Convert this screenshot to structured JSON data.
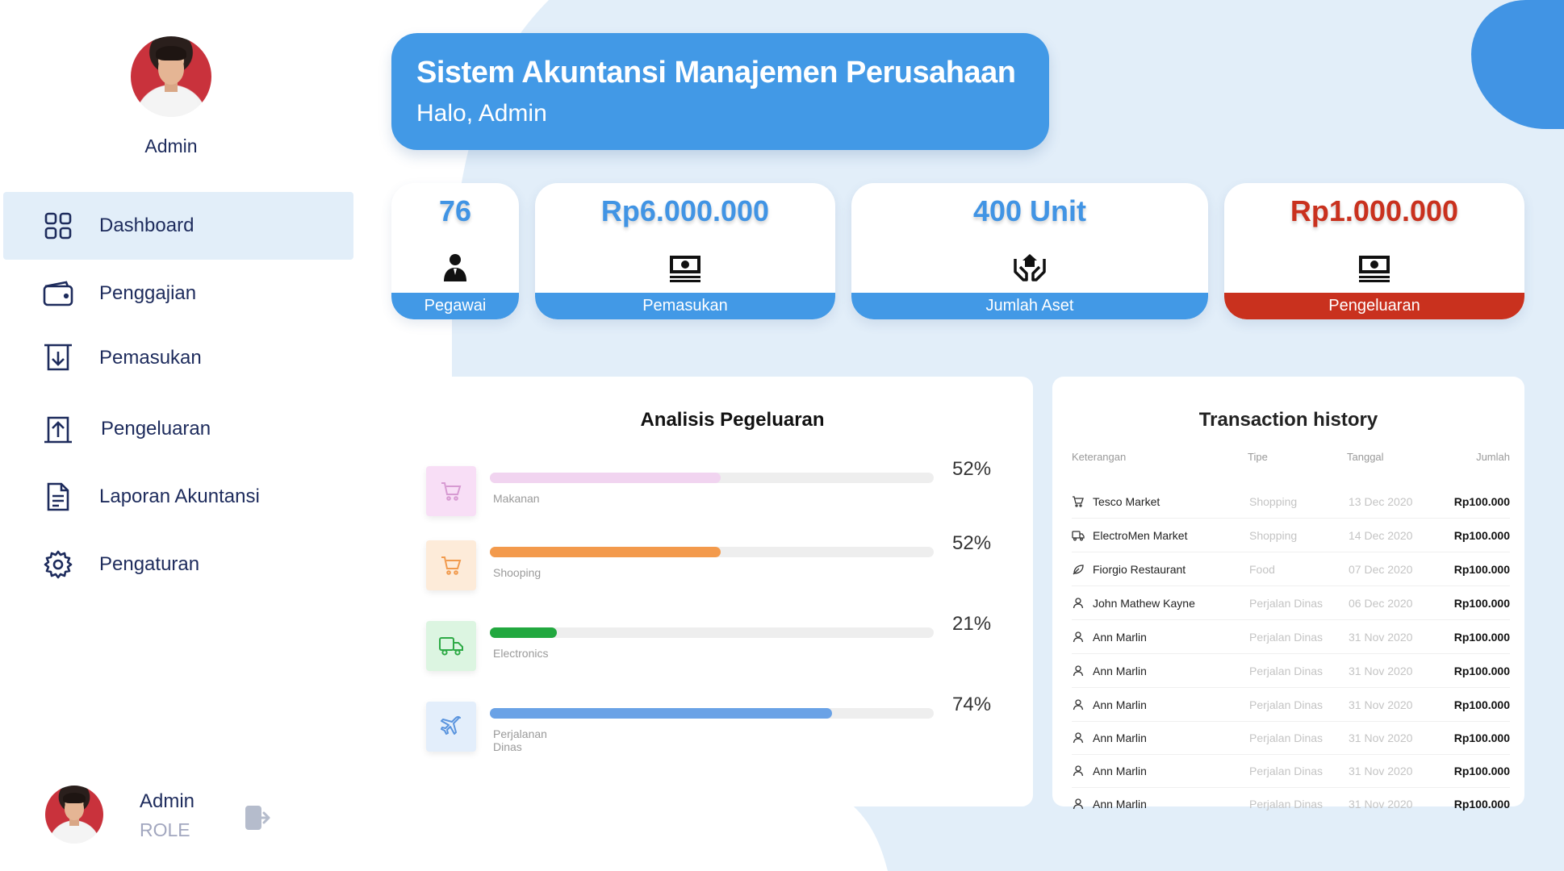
{
  "profile": {
    "name": "Admin",
    "role": "ROLE"
  },
  "nav": {
    "items": [
      {
        "label": "Dashboard",
        "icon": "dashboard-grid-icon",
        "active": true
      },
      {
        "label": "Penggajian",
        "icon": "wallet-icon"
      },
      {
        "label": "Pemasukan",
        "icon": "income-tray-icon"
      },
      {
        "label": "Pengeluaran",
        "icon": "expense-upload-icon"
      },
      {
        "label": "Laporan Akuntansi",
        "icon": "document-icon"
      },
      {
        "label": "Pengaturan",
        "icon": "gear-icon"
      }
    ]
  },
  "header": {
    "title": "Sistem Akuntansi Manajemen Perusahaan",
    "greeting": "Halo, Admin"
  },
  "stats": [
    {
      "value": "76",
      "label": "Pegawai",
      "icon": "employee-icon",
      "color": "#4299e6"
    },
    {
      "value": "Rp6.000.000",
      "label": "Pemasukan",
      "icon": "money-bill-icon",
      "color": "#4299e6"
    },
    {
      "value": "400 Unit",
      "label": "Jumlah Aset",
      "icon": "hands-house-icon",
      "color": "#4299e6"
    },
    {
      "value": "Rp1.000.000",
      "label": "Pengeluaran",
      "icon": "money-bill-icon",
      "color": "#c9311e"
    }
  ],
  "analysis": {
    "title": "Analisis Pegeluaran",
    "rows": [
      {
        "category": "Makanan",
        "percent_label": "52%",
        "fill_percent": 52,
        "bar_color": "#f1d4f0",
        "icon_bg": "#f8def6",
        "icon_color": "#d79ad2",
        "icon": "cart-icon"
      },
      {
        "category": "Shooping",
        "percent_label": "52%",
        "fill_percent": 52,
        "bar_color": "#f39a4c",
        "icon_bg": "#fdebd9",
        "icon_color": "#f19a4d",
        "icon": "cart-icon"
      },
      {
        "category": "Electronics",
        "percent_label": "21%",
        "fill_percent": 15,
        "bar_color": "#22a83f",
        "icon_bg": "#dcf5e1",
        "icon_color": "#2daa45",
        "icon": "truck-icon"
      },
      {
        "category": "Perjalanan Dinas",
        "percent_label": "74%",
        "fill_percent": 77,
        "bar_color": "#6aa2e6",
        "icon_bg": "#e3eefb",
        "icon_color": "#5a94de",
        "icon": "plane-icon"
      }
    ]
  },
  "history": {
    "title": "Transaction history",
    "columns": {
      "keterangan": "Keterangan",
      "tipe": "Tipe",
      "tanggal": "Tanggal",
      "jumlah": "Jumlah"
    },
    "rows": [
      {
        "icon": "cart-icon",
        "keterangan": "Tesco Market",
        "tipe": "Shopping",
        "tanggal": "13 Dec 2020",
        "jumlah": "Rp100.000"
      },
      {
        "icon": "truck-icon",
        "keterangan": "ElectroMen Market",
        "tipe": "Shopping",
        "tanggal": "14 Dec 2020",
        "jumlah": "Rp100.000"
      },
      {
        "icon": "leaf-icon",
        "keterangan": "Fiorgio Restaurant",
        "tipe": "Food",
        "tanggal": "07 Dec 2020",
        "jumlah": "Rp100.000"
      },
      {
        "icon": "person-icon",
        "keterangan": "John Mathew Kayne",
        "tipe": "Perjalan Dinas",
        "tanggal": "06 Dec 2020",
        "jumlah": "Rp100.000"
      },
      {
        "icon": "person-icon",
        "keterangan": "Ann Marlin",
        "tipe": "Perjalan Dinas",
        "tanggal": "31 Nov 2020",
        "jumlah": "Rp100.000"
      },
      {
        "icon": "person-icon",
        "keterangan": "Ann Marlin",
        "tipe": "Perjalan Dinas",
        "tanggal": "31 Nov 2020",
        "jumlah": "Rp100.000"
      },
      {
        "icon": "person-icon",
        "keterangan": "Ann Marlin",
        "tipe": "Perjalan Dinas",
        "tanggal": "31 Nov 2020",
        "jumlah": "Rp100.000"
      },
      {
        "icon": "person-icon",
        "keterangan": "Ann Marlin",
        "tipe": "Perjalan Dinas",
        "tanggal": "31 Nov 2020",
        "jumlah": "Rp100.000"
      },
      {
        "icon": "person-icon",
        "keterangan": "Ann Marlin",
        "tipe": "Perjalan Dinas",
        "tanggal": "31 Nov 2020",
        "jumlah": "Rp100.000"
      },
      {
        "icon": "person-icon",
        "keterangan": "Ann Marlin",
        "tipe": "Perjalan Dinas",
        "tanggal": "31 Nov 2020",
        "jumlah": "Rp100.000"
      }
    ]
  }
}
